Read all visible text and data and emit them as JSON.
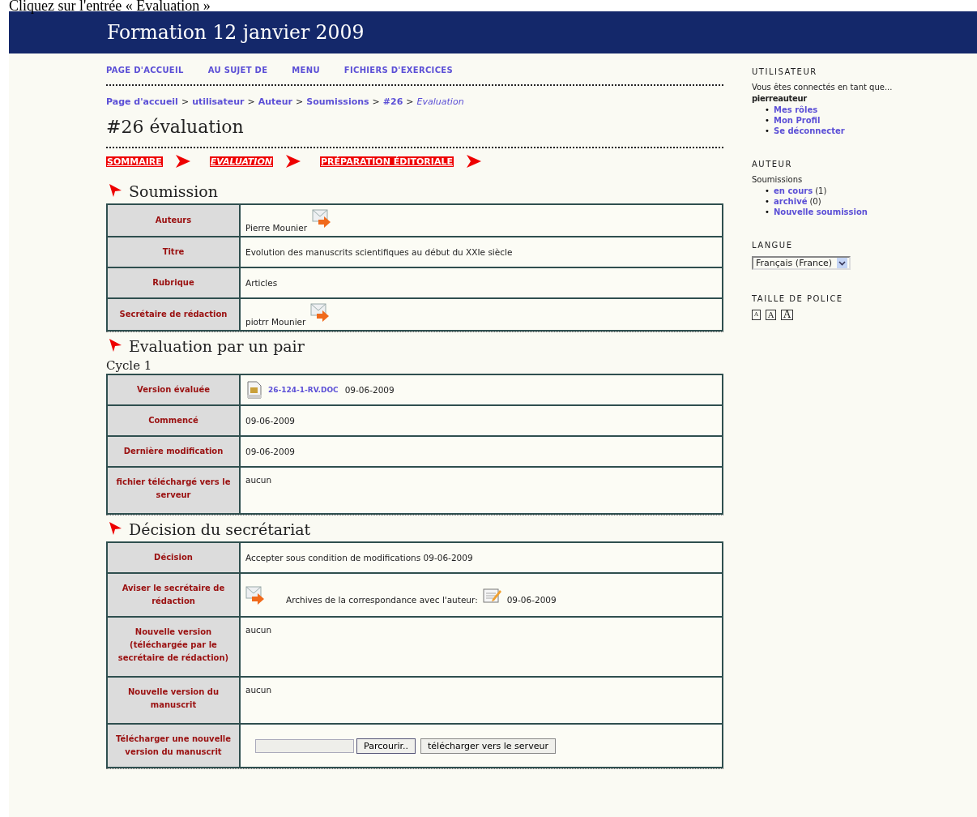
{
  "caption": "Cliquez sur l'entrée « Evaluation »",
  "site_title": "Formation 12 janvier 2009",
  "nav": [
    "PAGE D'ACCUEIL",
    "AU SUJET DE",
    "MENU",
    "FICHIERS D'EXERCICES"
  ],
  "breadcrumb": [
    {
      "label": "Page d'accueil",
      "current": false
    },
    {
      "separator": ">",
      "label": "utilisateur",
      "current": false
    },
    {
      "separator": ">",
      "label": "Auteur",
      "current": false
    },
    {
      "separator": ">",
      "label": "Soumissions",
      "current": false
    },
    {
      "separator": ">",
      "label": "#26",
      "current": false
    },
    {
      "separator": ">",
      "label": "Evaluation",
      "current": true
    }
  ],
  "page_title": "#26 évaluation",
  "steps": [
    {
      "label": "SOMMAIRE",
      "selected": false
    },
    {
      "label": "EVALUATION",
      "selected": true
    },
    {
      "label": "PRÉPARATION ÉDITORIALE",
      "selected": false
    }
  ],
  "sections": [
    {
      "title": "Soumission",
      "rows": [
        {
          "kind": "email",
          "label": "Auteurs",
          "value": "Pierre Mounier"
        },
        {
          "kind": "text",
          "label": "Titre",
          "value": "Evolution des manuscrits scientifiques au début du XXIe siècle"
        },
        {
          "kind": "text",
          "label": "Rubrique",
          "value": "Articles"
        },
        {
          "kind": "email",
          "label": "Secrétaire de rédaction",
          "value": "piotrr Mounier"
        }
      ]
    },
    {
      "title": "Evaluation par un pair",
      "subtitle": "Cycle 1",
      "rows": [
        {
          "kind": "file",
          "label": "Version évaluée",
          "link": "26-124-1-RV.DOC",
          "value": "09-06-2009"
        },
        {
          "kind": "text",
          "label": "Commencé",
          "value": "09-06-2009"
        },
        {
          "kind": "text",
          "label": "Dernière modification",
          "value": "09-06-2009"
        },
        {
          "kind": "note",
          "label": "fichier téléchargé vers le serveur",
          "value": "aucun"
        }
      ]
    },
    {
      "title": "Décision du secrétariat",
      "rows": [
        {
          "kind": "text",
          "label": "Décision",
          "value": "Accepter sous condition de modifications 09-06-2009"
        },
        {
          "kind": "notify",
          "label": "Aviser le secrétaire de rédaction",
          "value": "Archives de la correspondance avec l'auteur:",
          "date": "09-06-2009"
        },
        {
          "kind": "note",
          "label": "Nouvelle version (téléchargée par le secrétaire de rédaction)",
          "value": "aucun"
        },
        {
          "kind": "note",
          "label": "Nouvelle version du manuscrit",
          "value": "aucun"
        },
        {
          "kind": "upload",
          "label": "Télécharger une nouvelle version du manuscrit",
          "browse": "Parcourir..",
          "submit": "télécharger vers le serveur"
        }
      ]
    }
  ],
  "sidebar": {
    "user": {
      "heading": "UTILISATEUR",
      "intro": "Vous êtes connectés en tant que...",
      "username": "pierreauteur",
      "links": [
        {
          "bullet": "•",
          "label": "Mes rôles"
        },
        {
          "bullet": "•",
          "label": "Mon Profil"
        },
        {
          "bullet": "•",
          "label": "Se déconnecter"
        }
      ]
    },
    "author": {
      "heading": "AUTEUR",
      "intro": "Soumissions",
      "links": [
        {
          "bullet": "•",
          "label": "en cours",
          "count": "(1)"
        },
        {
          "bullet": "•",
          "label": "archivé",
          "count": "(0)"
        },
        {
          "bullet": "•",
          "label": "Nouvelle soumission"
        }
      ]
    },
    "language": {
      "heading": "LANGUE",
      "value": "Français (France)"
    },
    "font_size": {
      "heading": "TAILLE DE POLICE",
      "buttons": [
        "A",
        "A",
        "A"
      ]
    }
  }
}
